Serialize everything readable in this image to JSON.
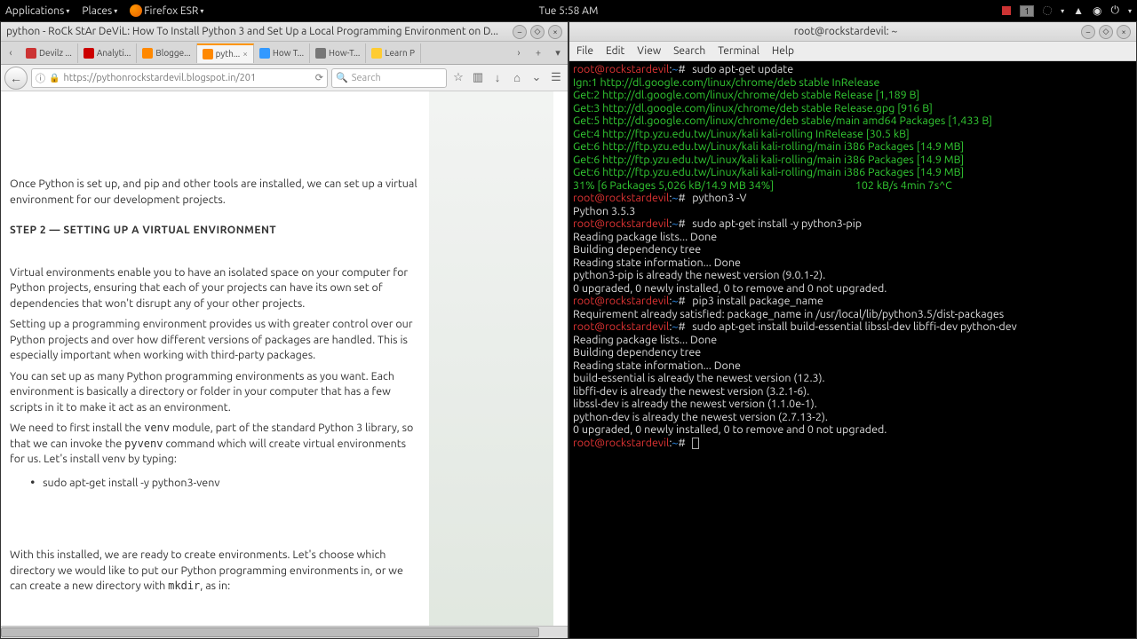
{
  "topbar": {
    "apps": "Applications",
    "places": "Places",
    "ff": "Firefox ESR",
    "clock": "Tue  5:58 AM",
    "badge": "1"
  },
  "firefox": {
    "title": "python - RoCk StAr DeViL: How To Install Python 3 and Set Up a Local Programming Environment on D...",
    "tabs": [
      {
        "label": "Devilz ..."
      },
      {
        "label": "Analyti..."
      },
      {
        "label": "Blogge..."
      },
      {
        "label": "pyth...",
        "active": true
      },
      {
        "label": "How T..."
      },
      {
        "label": "How-T..."
      },
      {
        "label": "Learn P"
      }
    ],
    "url": "https://pythonrockstardevil.blogspot.in/201",
    "search_ph": "Search",
    "article": {
      "p1": "Once Python is set up, and pip and other tools are installed, we can set up a virtual environment for our development projects.",
      "h": "STEP 2 — SETTING UP A VIRTUAL ENVIRONMENT",
      "p2": "Virtual environments enable you to have an isolated space on your computer for Python projects, ensuring that each of your projects can have its own set of dependencies that won't disrupt any of your other projects.",
      "p3": "Setting up a programming environment provides us with greater control over our Python projects and over how different versions of packages are handled. This is especially important when working with third-party packages.",
      "p4": "You can set up as many Python programming environments as you want. Each environment is basically a directory or folder in your computer that has a few scripts in it to make it act as an environment.",
      "p5a": "We need to first install the ",
      "p5b": "venv",
      "p5c": " module, part of the standard Python 3 library, so that we can invoke the ",
      "p5d": "pyvenv",
      "p5e": " command which will create virtual environments for us. Let's install venv by typing:",
      "cmd": "sudo apt-get install -y python3-venv",
      "p6a": "With this installed, we are ready to create environments. Let's choose which directory we would like to put our Python programming environments in, or we can create a new directory with ",
      "p6b": "mkdir",
      "p6c": ", as in:"
    }
  },
  "terminal": {
    "title": "root@rockstardevil: ~",
    "menus": [
      "File",
      "Edit",
      "View",
      "Search",
      "Terminal",
      "Help"
    ],
    "prompt_user": "root@rockstardevil",
    "prompt_path": "~",
    "lines": [
      {
        "cmd": "sudo apt-get update"
      },
      {
        "out": [
          "Ign:1 http://dl.google.com/linux/chrome/deb stable InRelease",
          "Get:2 http://dl.google.com/linux/chrome/deb stable Release [1,189 B]",
          "Get:3 http://dl.google.com/linux/chrome/deb stable Release.gpg [916 B]",
          "Get:5 http://dl.google.com/linux/chrome/deb stable/main amd64 Packages [1,433 B]",
          "Get:4 http://ftp.yzu.edu.tw/Linux/kali kali-rolling InRelease [30.5 kB]",
          "Get:6 http://ftp.yzu.edu.tw/Linux/kali kali-rolling/main i386 Packages [14.9 MB]",
          "Get:6 http://ftp.yzu.edu.tw/Linux/kali kali-rolling/main i386 Packages [14.9 MB]",
          "Get:6 http://ftp.yzu.edu.tw/Linux/kali kali-rolling/main i386 Packages [14.9 MB]"
        ]
      },
      {
        "progress": "31% [6 Packages 5,026 kB/14.9 MB 34%]                                102 kB/s 4min 7s^C"
      },
      {
        "cmd": "python3 -V"
      },
      {
        "plain": "Python 3.5.3"
      },
      {
        "cmd": "sudo apt-get install -y python3-pip"
      },
      {
        "plain": "Reading package lists... Done"
      },
      {
        "plain": "Building dependency tree"
      },
      {
        "plain": "Reading state information... Done"
      },
      {
        "plain": "python3-pip is already the newest version (9.0.1-2)."
      },
      {
        "plain": "0 upgraded, 0 newly installed, 0 to remove and 0 not upgraded."
      },
      {
        "cmd": "pip3 install package_name"
      },
      {
        "plain": "Requirement already satisfied: package_name in /usr/local/lib/python3.5/dist-packages"
      },
      {
        "cmd": "sudo apt-get install build-essential libssl-dev libffi-dev python-dev"
      },
      {
        "plain": "Reading package lists... Done"
      },
      {
        "plain": "Building dependency tree"
      },
      {
        "plain": "Reading state information... Done"
      },
      {
        "plain": "build-essential is already the newest version (12.3)."
      },
      {
        "plain": "libffi-dev is already the newest version (3.2.1-6)."
      },
      {
        "plain": "libssl-dev is already the newest version (1.1.0e-1)."
      },
      {
        "plain": "python-dev is already the newest version (2.7.13-2)."
      },
      {
        "plain": "0 upgraded, 0 newly installed, 0 to remove and 0 not upgraded."
      },
      {
        "cmd": ""
      }
    ]
  }
}
